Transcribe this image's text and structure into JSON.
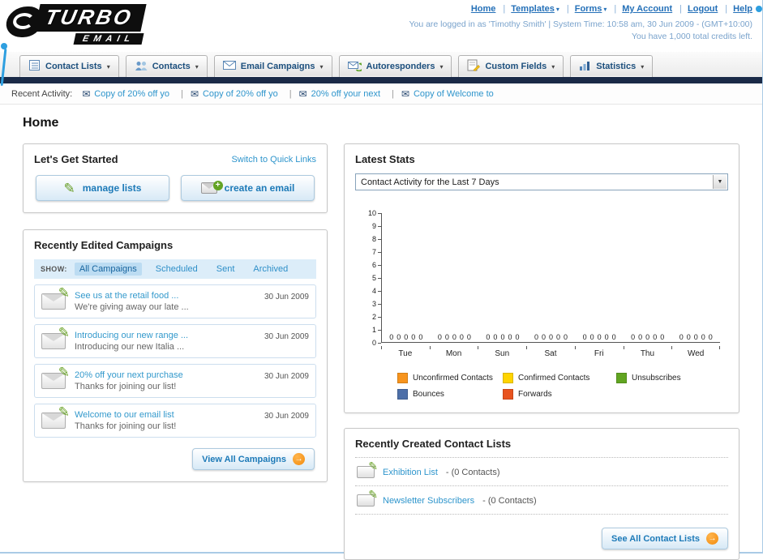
{
  "icons": {
    "pencil": "✎",
    "envelope": "✉",
    "arrow_right": "→",
    "dropdown_arrow": "▾",
    "select_arrow": "▼",
    "plus": "+"
  },
  "header": {
    "logo_primary": "TURBO",
    "logo_secondary": "EMAIL",
    "nav": [
      {
        "label": "Home"
      },
      {
        "label": "Templates"
      },
      {
        "label": "Forms"
      },
      {
        "label": "My Account"
      },
      {
        "label": "Logout"
      },
      {
        "label": "Help"
      }
    ],
    "login_info": "You are logged in as 'Timothy Smith' | System Time: 10:58 am, 30 Jun 2009 - (GMT+10:00)",
    "credits": "You have 1,000 total credits left."
  },
  "main_nav": {
    "items": [
      {
        "label": "Contact Lists"
      },
      {
        "label": "Contacts"
      },
      {
        "label": "Email Campaigns"
      },
      {
        "label": "Autoresponders"
      },
      {
        "label": "Custom Fields"
      },
      {
        "label": "Statistics"
      }
    ]
  },
  "recent_activity": {
    "label": "Recent Activity:",
    "items": [
      "Copy of 20% off yo",
      "Copy of 20% off yo",
      "20% off your next",
      "Copy of Welcome to"
    ]
  },
  "page": {
    "title": "Home"
  },
  "get_started": {
    "title": "Let's Get Started",
    "switch_link": "Switch to Quick Links",
    "manage_lists": "manage lists",
    "create_email": "create an email"
  },
  "campaigns": {
    "title": "Recently Edited Campaigns",
    "show_label": "SHOW:",
    "tabs": [
      {
        "label": "All Campaigns",
        "selected": true
      },
      {
        "label": "Scheduled",
        "selected": false
      },
      {
        "label": "Sent",
        "selected": false
      },
      {
        "label": "Archived",
        "selected": false
      }
    ],
    "items": [
      {
        "title": "See us at the retail food ...",
        "subtitle": "We're giving away our late ...",
        "date": "30 Jun 2009"
      },
      {
        "title": "Introducing our new range ...",
        "subtitle": "Introducing our new Italia ...",
        "date": "30 Jun 2009"
      },
      {
        "title": "20% off your next purchase",
        "subtitle": "Thanks for joining our list!",
        "date": "30 Jun 2009"
      },
      {
        "title": "Welcome to our email list",
        "subtitle": "Thanks for joining our list!",
        "date": "30 Jun 2009"
      }
    ],
    "view_all": "View All Campaigns"
  },
  "stats": {
    "title": "Latest Stats",
    "period_selected": "Contact Activity for the Last 7 Days",
    "chart_data": {
      "type": "bar",
      "categories": [
        "Tue",
        "Mon",
        "Sun",
        "Sat",
        "Fri",
        "Thu",
        "Wed"
      ],
      "series": [
        {
          "name": "Unconfirmed Contacts",
          "color": "#f7941d",
          "values": [
            0,
            0,
            0,
            0,
            0,
            0,
            0
          ]
        },
        {
          "name": "Confirmed Contacts",
          "color": "#ffd400",
          "values": [
            0,
            0,
            0,
            0,
            0,
            0,
            0
          ]
        },
        {
          "name": "Unsubscribes",
          "color": "#61a521",
          "values": [
            0,
            0,
            0,
            0,
            0,
            0,
            0
          ]
        },
        {
          "name": "Bounces",
          "color": "#4d6fa8",
          "values": [
            0,
            0,
            0,
            0,
            0,
            0,
            0
          ]
        },
        {
          "name": "Forwards",
          "color": "#e8531f",
          "values": [
            0,
            0,
            0,
            0,
            0,
            0,
            0
          ]
        }
      ],
      "ylim": [
        0,
        10
      ],
      "grid": false,
      "legend_position": "bottom"
    }
  },
  "contact_lists": {
    "title": "Recently Created Contact Lists",
    "items": [
      {
        "name": "Exhibition List",
        "detail": "- (0 Contacts)"
      },
      {
        "name": "Newsletter Subscribers",
        "detail": "- (0 Contacts)"
      }
    ],
    "see_all": "See All Contact Lists"
  }
}
